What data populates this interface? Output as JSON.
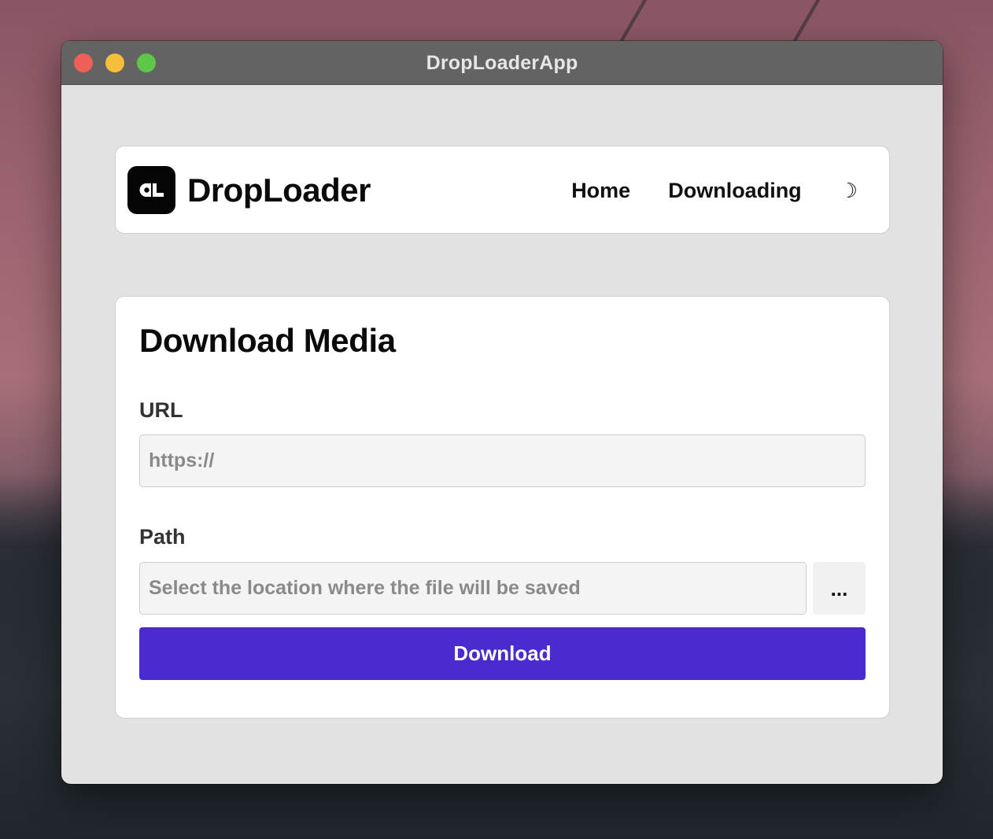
{
  "window": {
    "title": "DropLoaderApp"
  },
  "navbar": {
    "brand": "DropLoader",
    "logo_icon": "droploader-logo-icon",
    "links": [
      {
        "label": "Home"
      },
      {
        "label": "Downloading"
      }
    ],
    "theme_toggle": "☽"
  },
  "form": {
    "title": "Download Media",
    "url_label": "URL",
    "url_placeholder": "https://",
    "url_value": "",
    "path_label": "Path",
    "path_placeholder": "Select the location where the file will be saved",
    "path_value": "",
    "browse_label": "...",
    "download_label": "Download"
  },
  "colors": {
    "accent": "#4b2bd0",
    "titlebar": "#636363",
    "window_bg": "#e2e2e2",
    "close": "#ee5f58",
    "minimize": "#f6be3a",
    "maximize": "#5ec747"
  }
}
